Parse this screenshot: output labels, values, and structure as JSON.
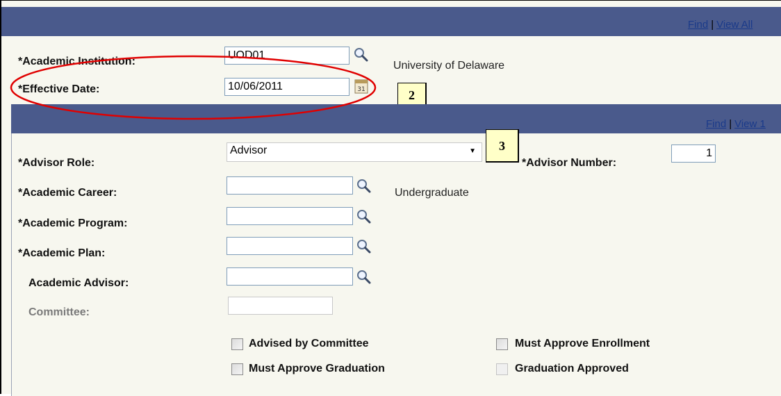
{
  "top_nav": {
    "find": "Find",
    "view_all": "View All"
  },
  "institution": {
    "label": "*Academic Institution:",
    "value": "UOD01",
    "description": "University of Delaware"
  },
  "effective_date": {
    "label": "*Effective Date:",
    "value": "10/06/2011"
  },
  "callouts": {
    "c2": "2",
    "c3": "3"
  },
  "panel_nav": {
    "find": "Find",
    "view": "View 1"
  },
  "advisor_role": {
    "label": "*Advisor Role:",
    "value": "Advisor"
  },
  "advisor_number": {
    "label": "*Advisor Number:",
    "value": "1"
  },
  "academic_career": {
    "label": "*Academic Career:",
    "value": "",
    "description": "Undergraduate"
  },
  "academic_program": {
    "label": "*Academic Program:",
    "value": ""
  },
  "academic_plan": {
    "label": "*Academic Plan:",
    "value": ""
  },
  "academic_advisor": {
    "label": "Academic Advisor:",
    "value": ""
  },
  "committee": {
    "label": "Committee:",
    "value": ""
  },
  "checkboxes": {
    "advised_by_committee": "Advised by Committee",
    "must_approve_enrollment": "Must Approve Enrollment",
    "must_approve_graduation": "Must Approve Graduation",
    "graduation_approved": "Graduation Approved"
  },
  "icons": {
    "lookup": "magnifier-icon",
    "calendar": "calendar-icon",
    "dropdown": "caret-down-icon"
  },
  "colors": {
    "header_bar": "#4a5a8c",
    "background": "#f7f7ef",
    "callout": "#ffffc8",
    "ellipse": "#e00000",
    "link": "#1a3a8a"
  }
}
